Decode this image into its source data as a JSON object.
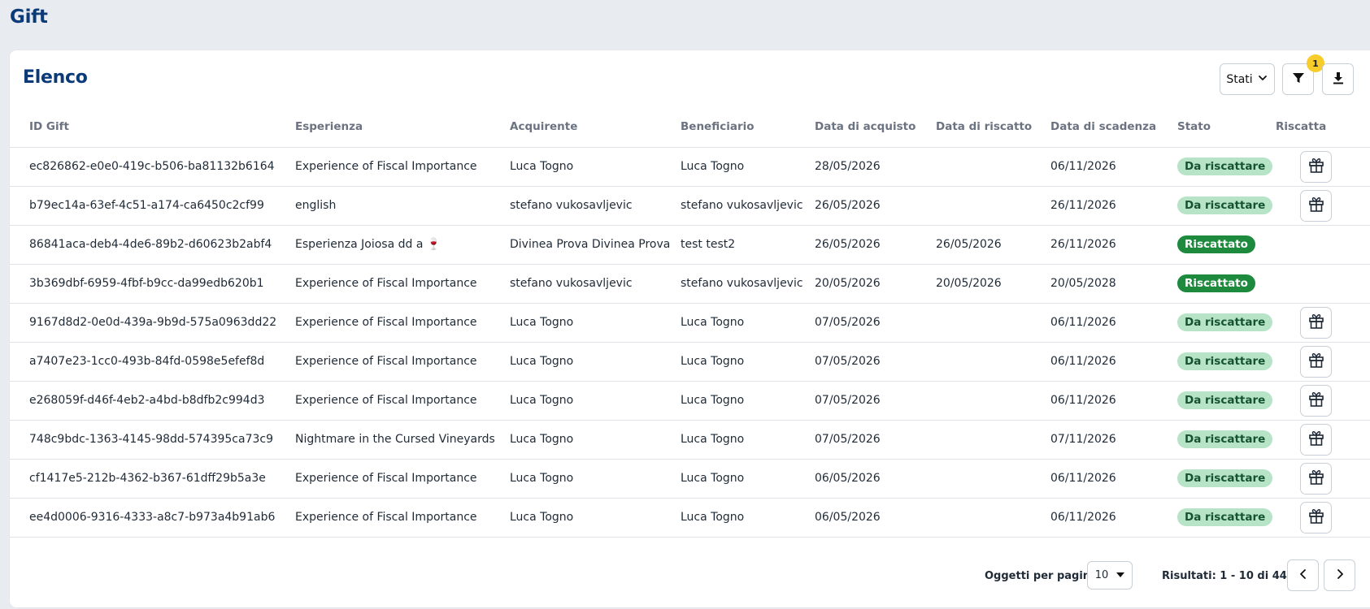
{
  "page": {
    "title": "Gift"
  },
  "card": {
    "title": "Elenco"
  },
  "toolbar": {
    "stati_label": "Stati",
    "filter_badge": "1"
  },
  "table": {
    "headers": {
      "id": "ID Gift",
      "esperienza": "Esperienza",
      "acquirente": "Acquirente",
      "beneficiario": "Beneficiario",
      "data_acquisto": "Data di acquisto",
      "data_riscatto": "Data di riscatto",
      "data_scadenza": "Data di scadenza",
      "stato": "Stato",
      "riscatta": "Riscatta"
    },
    "rows": [
      {
        "id": "ec826862-e0e0-419c-b506-ba81132b6164",
        "esperienza": "Experience of Fiscal Importance",
        "acquirente": "Luca Togno",
        "beneficiario": "Luca Togno",
        "data_acquisto": "28/05/2026",
        "data_riscatto": "",
        "data_scadenza": "06/11/2026",
        "stato": "Da riscattare",
        "redeemable": true
      },
      {
        "id": "b79ec14a-63ef-4c51-a174-ca6450c2cf99",
        "esperienza": "english",
        "acquirente": "stefano vukosavljevic",
        "beneficiario": "stefano vukosavljevic",
        "data_acquisto": "26/05/2026",
        "data_riscatto": "",
        "data_scadenza": "26/11/2026",
        "stato": "Da riscattare",
        "redeemable": true
      },
      {
        "id": "86841aca-deb4-4de6-89b2-d60623b2abf4",
        "esperienza": "Esperienza Joiosa dd a 🍷",
        "acquirente": "Divinea Prova Divinea Prova",
        "beneficiario": "test test2",
        "data_acquisto": "26/05/2026",
        "data_riscatto": "26/05/2026",
        "data_scadenza": "26/11/2026",
        "stato": "Riscattato",
        "redeemable": false
      },
      {
        "id": "3b369dbf-6959-4fbf-b9cc-da99edb620b1",
        "esperienza": "Experience of Fiscal Importance",
        "acquirente": "stefano vukosavljevic",
        "beneficiario": "stefano vukosavljevic",
        "data_acquisto": "20/05/2026",
        "data_riscatto": "20/05/2026",
        "data_scadenza": "20/05/2028",
        "stato": "Riscattato",
        "redeemable": false
      },
      {
        "id": "9167d8d2-0e0d-439a-9b9d-575a0963dd22",
        "esperienza": "Experience of Fiscal Importance",
        "acquirente": "Luca Togno",
        "beneficiario": "Luca Togno",
        "data_acquisto": "07/05/2026",
        "data_riscatto": "",
        "data_scadenza": "06/11/2026",
        "stato": "Da riscattare",
        "redeemable": true
      },
      {
        "id": "a7407e23-1cc0-493b-84fd-0598e5efef8d",
        "esperienza": "Experience of Fiscal Importance",
        "acquirente": "Luca Togno",
        "beneficiario": "Luca Togno",
        "data_acquisto": "07/05/2026",
        "data_riscatto": "",
        "data_scadenza": "06/11/2026",
        "stato": "Da riscattare",
        "redeemable": true
      },
      {
        "id": "e268059f-d46f-4eb2-a4bd-b8dfb2c994d3",
        "esperienza": "Experience of Fiscal Importance",
        "acquirente": "Luca Togno",
        "beneficiario": "Luca Togno",
        "data_acquisto": "07/05/2026",
        "data_riscatto": "",
        "data_scadenza": "06/11/2026",
        "stato": "Da riscattare",
        "redeemable": true
      },
      {
        "id": "748c9bdc-1363-4145-98dd-574395ca73c9",
        "esperienza": "Nightmare in the Cursed Vineyards",
        "acquirente": "Luca Togno",
        "beneficiario": "Luca Togno",
        "data_acquisto": "07/05/2026",
        "data_riscatto": "",
        "data_scadenza": "07/11/2026",
        "stato": "Da riscattare",
        "redeemable": true
      },
      {
        "id": "cf1417e5-212b-4362-b367-61dff29b5a3e",
        "esperienza": "Experience of Fiscal Importance",
        "acquirente": "Luca Togno",
        "beneficiario": "Luca Togno",
        "data_acquisto": "06/05/2026",
        "data_riscatto": "",
        "data_scadenza": "06/11/2026",
        "stato": "Da riscattare",
        "redeemable": true
      },
      {
        "id": "ee4d0006-9316-4333-a8c7-b973a4b91ab6",
        "esperienza": "Experience of Fiscal Importance",
        "acquirente": "Luca Togno",
        "beneficiario": "Luca Togno",
        "data_acquisto": "06/05/2026",
        "data_riscatto": "",
        "data_scadenza": "06/11/2026",
        "stato": "Da riscattare",
        "redeemable": true
      }
    ]
  },
  "pagination": {
    "per_page_label": "Oggetti per pagina:",
    "per_page_value": "10",
    "results_label": "Risultati: 1 - 10 di 44"
  },
  "icons": {
    "filter": "filter-icon",
    "download": "download-icon",
    "gift": "gift-icon",
    "prev": "chevron-left-icon",
    "next": "chevron-right-icon",
    "dropdown": "chevron-down-icon"
  },
  "colors": {
    "title": "#0b3a78",
    "badge": "#f7cc2b",
    "pending_bg": "#b7e4c7",
    "pending_text": "#14532d",
    "done_bg": "#1e8a3e",
    "done_text": "#ffffff"
  }
}
